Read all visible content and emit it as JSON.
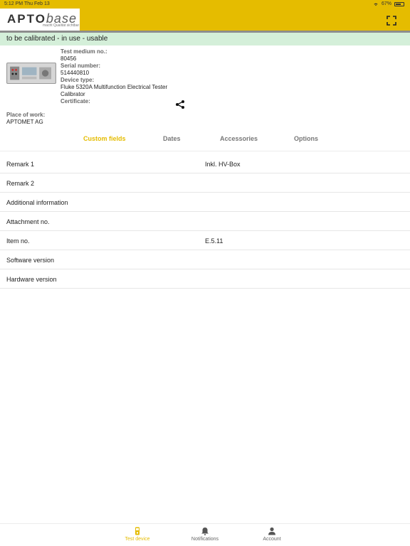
{
  "status_bar": {
    "time": "5:12 PM",
    "date": "Thu Feb 13",
    "battery": "67%"
  },
  "logo": {
    "apto": "APTO",
    "base": "base",
    "tagline": "macht Qualität sichtbar"
  },
  "banner": {
    "text": "to be calibrated - in use - usable"
  },
  "device": {
    "test_medium_label": "Test medium no.:",
    "test_medium_value": "80456",
    "serial_label": "Serial number:",
    "serial_value": "514440810",
    "type_label": "Device type:",
    "type_value_line1": "Fluke 5320A Multifunction Electrical Tester",
    "type_value_line2": "Calibrator",
    "certificate_label": "Certificate:",
    "place_label": "Place of work:",
    "place_value": "APTOMET AG"
  },
  "tabs": [
    {
      "label": "Custom fields",
      "active": true
    },
    {
      "label": "Dates",
      "active": false
    },
    {
      "label": "Accessories",
      "active": false
    },
    {
      "label": "Options",
      "active": false
    }
  ],
  "fields": [
    {
      "label": "Remark 1",
      "value": "Inkl. HV-Box"
    },
    {
      "label": "Remark 2",
      "value": ""
    },
    {
      "label": "Additional information",
      "value": ""
    },
    {
      "label": "Attachment no.",
      "value": ""
    },
    {
      "label": "Item no.",
      "value": "E.5.11"
    },
    {
      "label": "Software version",
      "value": ""
    },
    {
      "label": "Hardware version",
      "value": ""
    }
  ],
  "nav": [
    {
      "label": "Test device",
      "icon": "test-device-icon",
      "active": true
    },
    {
      "label": "Notifications",
      "icon": "bell-icon",
      "active": false
    },
    {
      "label": "Account",
      "icon": "person-icon",
      "active": false
    }
  ],
  "colors": {
    "accent": "#e5bc00",
    "banner": "#d4efd9"
  }
}
